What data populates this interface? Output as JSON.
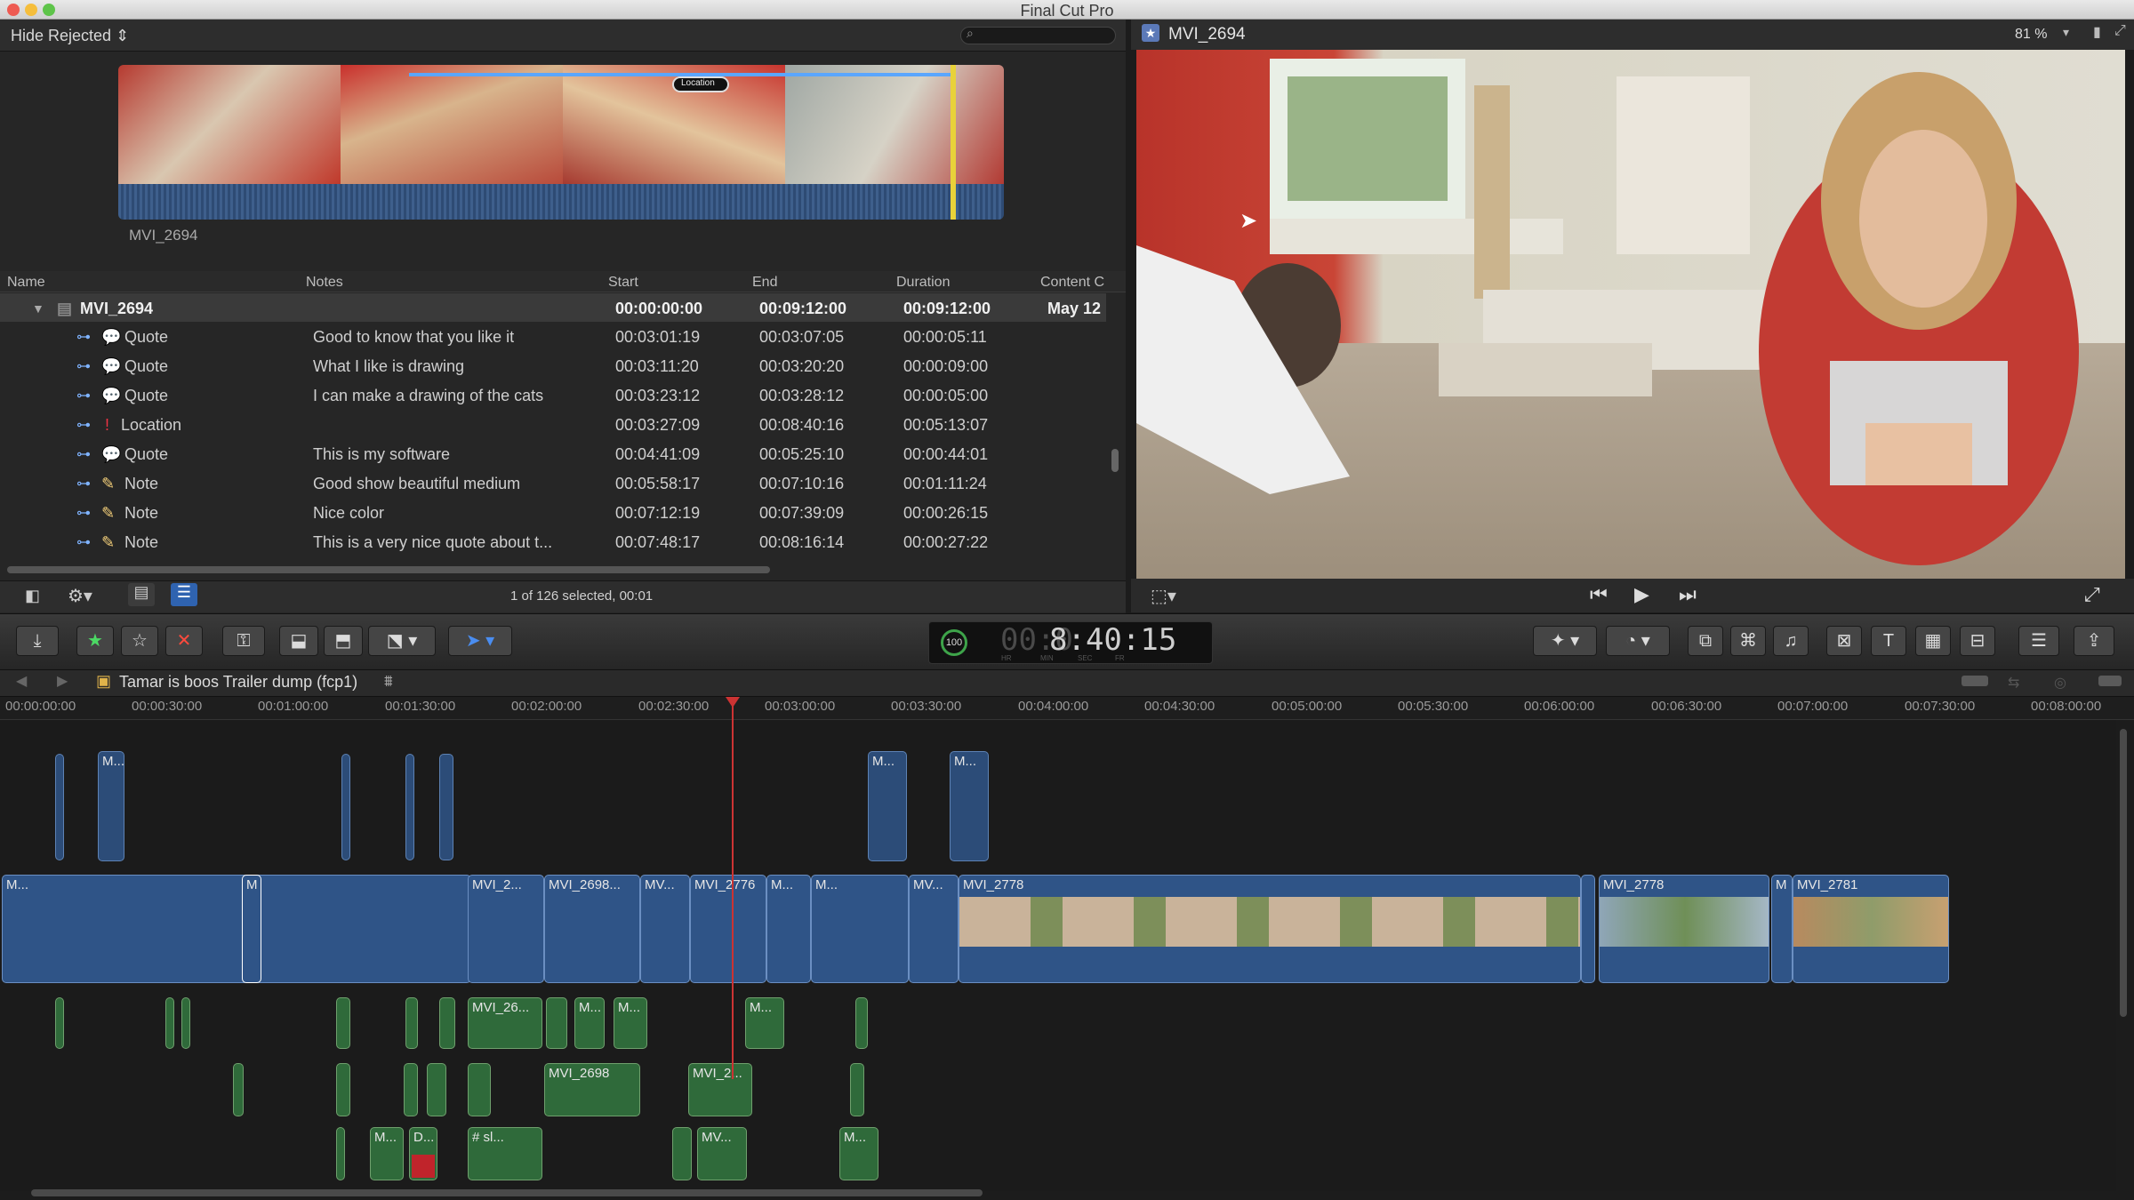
{
  "app": {
    "title": "Final Cut Pro"
  },
  "browser": {
    "filter_label": "Hide Rejected ⇕",
    "clip_name": "MVI_2694",
    "columns": [
      "Name",
      "Notes",
      "Start",
      "End",
      "Duration",
      "Content C"
    ],
    "parent_row": {
      "name": "MVI_2694",
      "notes": "",
      "start": "00:00:00:00",
      "end": "00:09:12:00",
      "duration": "00:09:12:00",
      "content": "May 12"
    },
    "rows": [
      {
        "type": "Quote",
        "notes": "Good to know that you like it",
        "start": "00:03:01:19",
        "end": "00:03:07:05",
        "duration": "00:00:05:11"
      },
      {
        "type": "Quote",
        "notes": "What I like is drawing",
        "start": "00:03:11:20",
        "end": "00:03:20:20",
        "duration": "00:00:09:00"
      },
      {
        "type": "Quote",
        "notes": "I can make a drawing of the cats",
        "start": "00:03:23:12",
        "end": "00:03:28:12",
        "duration": "00:00:05:00"
      },
      {
        "type": "Location",
        "notes": "",
        "start": "00:03:27:09",
        "end": "00:08:40:16",
        "duration": "00:05:13:07"
      },
      {
        "type": "Quote",
        "notes": "This is my software",
        "start": "00:04:41:09",
        "end": "00:05:25:10",
        "duration": "00:00:44:01"
      },
      {
        "type": "Note",
        "notes": "Good show beautiful medium",
        "start": "00:05:58:17",
        "end": "00:07:10:16",
        "duration": "00:01:11:24"
      },
      {
        "type": "Note",
        "notes": "Nice color",
        "start": "00:07:12:19",
        "end": "00:07:39:09",
        "duration": "00:00:26:15"
      },
      {
        "type": "Note",
        "notes": "This is a very nice quote about t...",
        "start": "00:07:48:17",
        "end": "00:08:16:14",
        "duration": "00:00:27:22"
      }
    ],
    "selection_status": "1 of 126 selected, 00:01",
    "marker_label": "Location"
  },
  "viewer": {
    "title": "MVI_2694",
    "zoom": "81 %"
  },
  "toolbar": {
    "timecode": "8:40:15",
    "timecode_dim": "00:0",
    "speed": "100",
    "timecode_units": [
      "HR",
      "MIN",
      "SEC",
      "FR"
    ]
  },
  "timeline": {
    "project_name": "Tamar is boos Trailer dump (fcp1)",
    "ruler": [
      "00:00:00:00",
      "00:00:30:00",
      "00:01:00:00",
      "00:01:30:00",
      "00:02:00:00",
      "00:02:30:00",
      "00:03:00:00",
      "00:03:30:00",
      "00:04:00:00",
      "00:04:30:00",
      "00:05:00:00",
      "00:05:30:00",
      "00:06:00:00",
      "00:06:30:00",
      "00:07:00:00",
      "00:07:30:00",
      "00:08:00:00"
    ],
    "clips": {
      "c1": "M...",
      "c2": "MVI_2...",
      "c3": "MVI_2698...",
      "c4": "MV...",
      "c5": "MVI_2776",
      "c6": "M...",
      "c7": "M...",
      "c8": "MV...",
      "c9": "MVI_2778",
      "c10": "MVI_2778",
      "c11": "M",
      "c12": "MVI_2781",
      "c13": "M",
      "a1": "MVI_26...",
      "a2": "M...",
      "a3": "M...",
      "a4": "M...",
      "a5": "MVI_2698",
      "a6": "MVI_2...",
      "a7": "M...",
      "a8": "D...",
      "a9": "# sl...",
      "a10": "MV...",
      "a11": "M...",
      "u1": "M...",
      "u2": "M...",
      "u3": "M..."
    }
  },
  "colors": {
    "accent": "#4a8df0",
    "primary_clip": "#2f5487",
    "audio_clip": "#2f6a3a",
    "playhead": "#e8d23a"
  }
}
